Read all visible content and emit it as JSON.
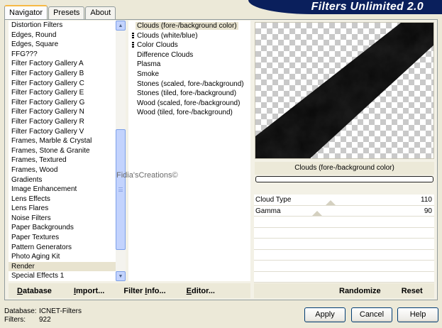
{
  "tabs": [
    {
      "label": "Navigator",
      "active": true
    },
    {
      "label": "Presets",
      "active": false
    },
    {
      "label": "About",
      "active": false
    }
  ],
  "app_title": "Filters Unlimited 2.0",
  "categories": {
    "items": [
      "Distortion Filters",
      "Edges, Round",
      "Edges, Square",
      "FFG???",
      "Filter Factory Gallery A",
      "Filter Factory Gallery B",
      "Filter Factory Gallery C",
      "Filter Factory Gallery E",
      "Filter Factory Gallery G",
      "Filter Factory Gallery N",
      "Filter Factory Gallery R",
      "Filter Factory Gallery V",
      "Frames, Marble & Crystal",
      "Frames, Stone & Granite",
      "Frames, Textured",
      "Frames, Wood",
      "Gradients",
      "Image Enhancement",
      "Lens Effects",
      "Lens Flares",
      "Noise Filters",
      "Paper Backgrounds",
      "Paper Textures",
      "Pattern Generators",
      "Photo Aging Kit",
      "Render",
      "Special Effects 1"
    ],
    "selected": "Render"
  },
  "filters": {
    "items": [
      {
        "label": "Clouds (fore-/background color)",
        "marked": false,
        "selected": true
      },
      {
        "label": "Clouds (white/blue)",
        "marked": true,
        "selected": false
      },
      {
        "label": "Color Clouds",
        "marked": true,
        "selected": false
      },
      {
        "label": "Difference Clouds",
        "marked": false,
        "selected": false
      },
      {
        "label": "Plasma",
        "marked": false,
        "selected": false
      },
      {
        "label": "Smoke",
        "marked": false,
        "selected": false
      },
      {
        "label": "Stones (scaled, fore-/background)",
        "marked": false,
        "selected": false
      },
      {
        "label": "Stones (tiled, fore-/background)",
        "marked": false,
        "selected": false
      },
      {
        "label": "Wood (scaled, fore-/background)",
        "marked": false,
        "selected": false
      },
      {
        "label": "Wood (tiled, fore-/background)",
        "marked": false,
        "selected": false
      }
    ]
  },
  "watermark": "Fidia'sCreations©",
  "preview": {
    "caption": "Clouds (fore-/background color)"
  },
  "params": [
    {
      "name": "Cloud Type",
      "value": "110"
    },
    {
      "name": "Gamma",
      "value": "90"
    }
  ],
  "toolbar": {
    "database": {
      "u": "D",
      "rest": "atabase"
    },
    "import": {
      "u": "I",
      "rest": "mport..."
    },
    "filter_info": {
      "pre": "Filter ",
      "u": "I",
      "rest": "nfo..."
    },
    "editor": {
      "u": "E",
      "rest": "ditor..."
    },
    "randomize": "Randomize",
    "reset": "Reset"
  },
  "status": {
    "database_label": "Database:",
    "database_value": "ICNET-Filters",
    "filters_label": "Filters:",
    "filters_value": "922"
  },
  "buttons": {
    "apply": "Apply",
    "cancel": "Cancel",
    "help": "Help"
  }
}
